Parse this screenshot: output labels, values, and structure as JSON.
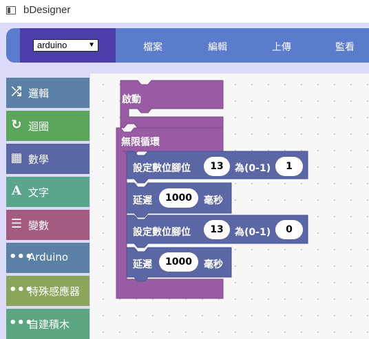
{
  "window": {
    "title": "bDesigner"
  },
  "navbar": {
    "board_selected": "arduino",
    "menu": [
      "檔案",
      "編輯",
      "上傳",
      "監看"
    ]
  },
  "toolbox": [
    {
      "label": "邏輯",
      "icon": "shuffle-icon",
      "color": "#5b80a5"
    },
    {
      "label": "迴圈",
      "icon": "loop-icon",
      "color": "#5ba55b"
    },
    {
      "label": "數學",
      "icon": "calculator-icon",
      "color": "#5b67a5"
    },
    {
      "label": "文字",
      "icon": "text-icon",
      "color": "#5ba58c"
    },
    {
      "label": "變數",
      "icon": "list-icon",
      "color": "#a55b80"
    },
    {
      "label": "Arduino",
      "icon": "dots-icon",
      "color": "#5b80a5"
    },
    {
      "label": "特殊感應器",
      "icon": "dots-icon",
      "color": "#8ba55b"
    },
    {
      "label": "自建積木",
      "icon": "dots-icon",
      "color": "#5ba580"
    }
  ],
  "blocks": {
    "setup_label": "啟動",
    "loop_label": "無限循環",
    "colors": {
      "event": "#9a5ba5",
      "io": "#5b67a5"
    },
    "statements": [
      {
        "type": "digital_write",
        "label": "設定數位腳位",
        "pin": "13",
        "mid": "為(0-1)",
        "value": "1"
      },
      {
        "type": "delay",
        "label": "延遲",
        "value": "1000",
        "unit": "毫秒"
      },
      {
        "type": "digital_write",
        "label": "設定數位腳位",
        "pin": "13",
        "mid": "為(0-1)",
        "value": "0"
      },
      {
        "type": "delay",
        "label": "延遲",
        "value": "1000",
        "unit": "毫秒"
      }
    ]
  }
}
